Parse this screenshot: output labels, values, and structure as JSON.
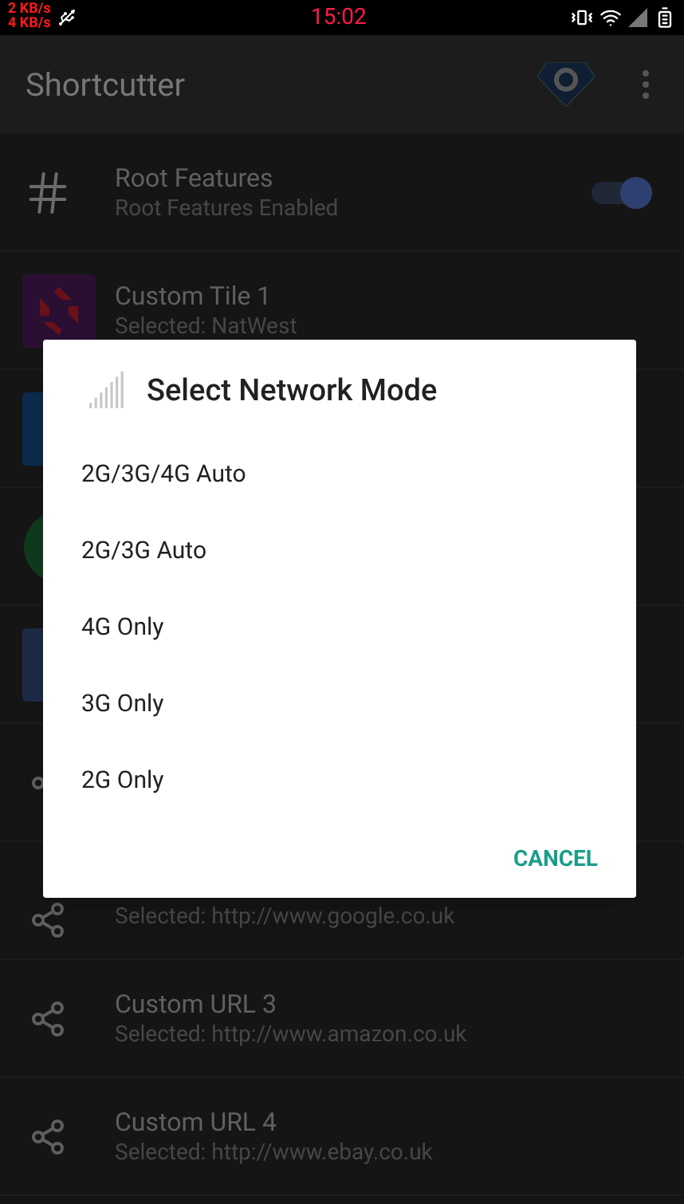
{
  "status_bar": {
    "upload": "2 KB/s",
    "download": "4 KB/s",
    "time": "15:02"
  },
  "app_bar": {
    "title": "Shortcutter"
  },
  "list": [
    {
      "kind": "hash",
      "title": "Root Features",
      "subtitle": "Root Features Enabled",
      "on": true
    },
    {
      "kind": "tile-red",
      "title": "Custom Tile 1",
      "subtitle": "Selected: NatWest"
    },
    {
      "kind": "tile-blue"
    },
    {
      "kind": "tile-pie"
    },
    {
      "kind": "tile-slate"
    },
    {
      "kind": "share"
    },
    {
      "kind": "share",
      "subtitle": "Selected: http://www.google.co.uk"
    },
    {
      "kind": "share",
      "title": "Custom URL 3",
      "subtitle": "Selected: http://www.amazon.co.uk"
    },
    {
      "kind": "share",
      "title": "Custom URL 4",
      "subtitle": "Selected: http://www.ebay.co.uk"
    }
  ],
  "dialog": {
    "title": "Select Network Mode",
    "options": [
      "2G/3G/4G Auto",
      "2G/3G Auto",
      "4G Only",
      "3G Only",
      "2G Only"
    ],
    "cancel": "CANCEL"
  }
}
